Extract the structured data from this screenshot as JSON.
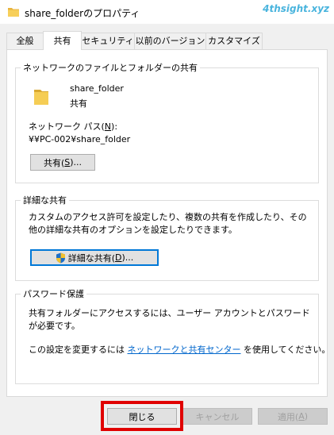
{
  "window": {
    "title": "share_folderのプロパティ",
    "watermark": "4thsight.xyz"
  },
  "tabs": [
    {
      "label": "全般",
      "active": false
    },
    {
      "label": "共有",
      "active": true
    },
    {
      "label": "セキュリティ",
      "active": false
    },
    {
      "label": "以前のバージョン",
      "active": false
    },
    {
      "label": "カスタマイズ",
      "active": false
    }
  ],
  "network_share": {
    "group_title": "ネットワークのファイルとフォルダーの共有",
    "folder_name": "share_folder",
    "folder_status": "共有",
    "path_label_prefix": "ネットワーク パス(",
    "path_label_key": "N",
    "path_label_suffix": "):",
    "path_value": "¥¥PC-002¥share_folder",
    "share_button": {
      "prefix": "共有(",
      "key": "S",
      "suffix": ")..."
    }
  },
  "advanced_share": {
    "group_title": "詳細な共有",
    "description": "カスタムのアクセス許可を設定したり、複数の共有を作成したり、その他の詳細な共有のオプションを設定したりできます。",
    "button": {
      "prefix": "詳細な共有(",
      "key": "D",
      "suffix": ")..."
    }
  },
  "password_protection": {
    "group_title": "パスワード保護",
    "description": "共有フォルダーにアクセスするには、ユーザー アカウントとパスワードが必要です。",
    "change_text_prefix": "この設定を変更するには ",
    "link_text": "ネットワークと共有センター",
    "change_text_suffix": " を使用してください。"
  },
  "footer": {
    "close_label": "閉じる",
    "cancel_label": "キャンセル",
    "apply_prefix": "適用(",
    "apply_key": "A",
    "apply_suffix": ")"
  },
  "colors": {
    "link": "#0066cc",
    "focus_border": "#0078d7",
    "highlight": "#e00000",
    "folder": "#f2c24a"
  }
}
